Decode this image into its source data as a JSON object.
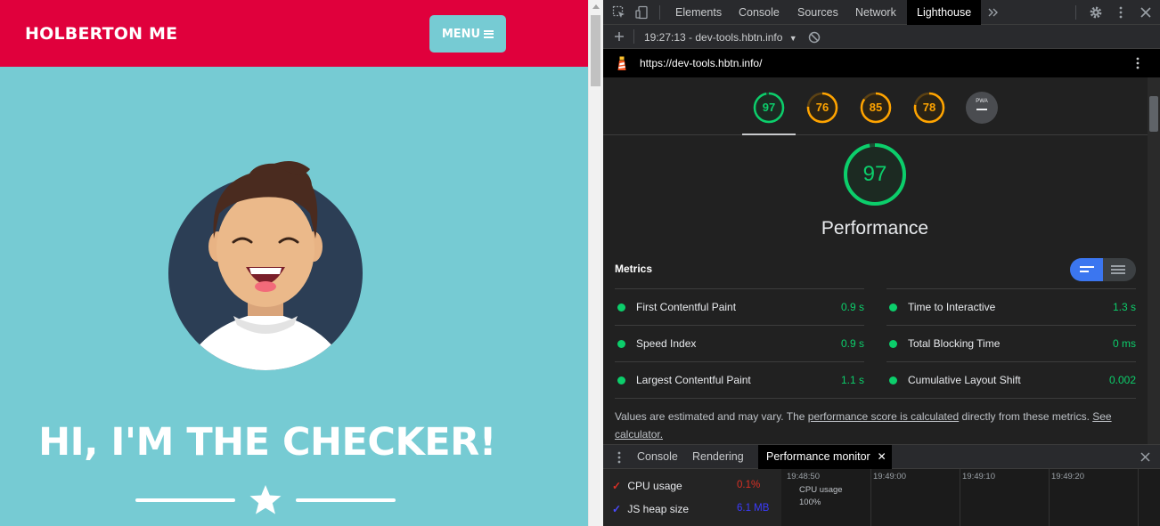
{
  "page": {
    "logo": "HOLBERTON ME",
    "menu_label": "MENU",
    "hero_title": "HI, I'M THE CHECKER!"
  },
  "devtools": {
    "tabs": [
      "Elements",
      "Console",
      "Sources",
      "Network",
      "Lighthouse"
    ],
    "active_tab": "Lighthouse",
    "toolbar": {
      "report_label": "19:27:13 - dev-tools.hbtn.info"
    },
    "url": "https://dev-tools.hbtn.info/",
    "scores": [
      {
        "value": "97",
        "color": "#0cce6b"
      },
      {
        "value": "76",
        "color": "#ffa400"
      },
      {
        "value": "85",
        "color": "#ffa400"
      },
      {
        "value": "78",
        "color": "#ffa400"
      }
    ],
    "pwa_label": "PWA",
    "performance": {
      "score": "97",
      "title": "Performance",
      "metrics_heading": "Metrics",
      "metrics": [
        {
          "name": "First Contentful Paint",
          "value": "0.9 s"
        },
        {
          "name": "Time to Interactive",
          "value": "1.3 s"
        },
        {
          "name": "Speed Index",
          "value": "0.9 s"
        },
        {
          "name": "Total Blocking Time",
          "value": "0 ms"
        },
        {
          "name": "Largest Contentful Paint",
          "value": "1.1 s"
        },
        {
          "name": "Cumulative Layout Shift",
          "value": "0.002"
        }
      ],
      "note_prefix": "Values are estimated and may vary. The ",
      "note_link": "performance score is calculated",
      "note_middle": " directly from these metrics. ",
      "note_link2": "See calculator."
    },
    "drawer": {
      "tabs": [
        "Console",
        "Rendering",
        "Performance monitor"
      ],
      "active_tab": "Performance monitor",
      "monitor": {
        "rows": [
          {
            "label": "CPU usage",
            "value": "0.1%",
            "color": "#d93025"
          },
          {
            "label": "JS heap size",
            "value": "6.1 MB",
            "color": "#1a1aff"
          }
        ],
        "ticks": [
          "19:48:50",
          "19:49:00",
          "19:49:10",
          "19:49:20"
        ],
        "graph_label": "CPU usage",
        "graph_scale": "100%"
      }
    }
  }
}
